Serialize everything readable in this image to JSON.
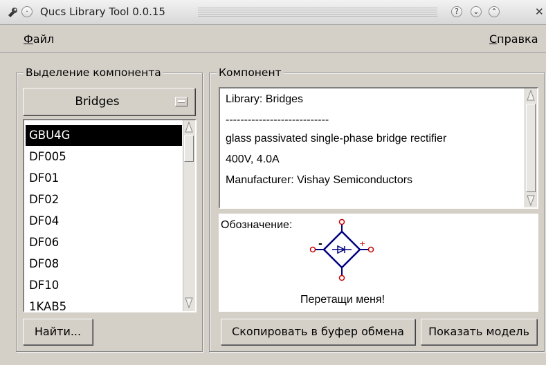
{
  "window": {
    "title": "Qucs Library Tool 0.0.15",
    "help_glyph": "?",
    "minimize_glyph": "⌄",
    "maximize_glyph": "⌃",
    "close_glyph": "✕"
  },
  "menu": {
    "file_first": "Ф",
    "file_rest": "айл",
    "help_first": "С",
    "help_rest": "правка"
  },
  "selection_group": {
    "title": "Выделение компонента",
    "library_selected": "Bridges",
    "items": [
      "GBU4G",
      "DF005",
      "DF01",
      "DF02",
      "DF04",
      "DF06",
      "DF08",
      "DF10",
      "1KAB5"
    ],
    "selected_index": 0,
    "search_button": "Найти..."
  },
  "component_group": {
    "title": "Компонент",
    "info_lines": [
      "Library: Bridges",
      "----------------------------",
      "glass passivated single-phase bridge rectifier",
      "400V, 4.0A",
      "Manufacturer: Vishay Semiconductors"
    ],
    "symbol_label": "Обозначение:",
    "drag_hint": "Перетащи меня!",
    "minus_sign": "-",
    "plus_sign": "+",
    "copy_button": "Скопировать в буфер обмена",
    "show_model_button": "Показать модель"
  },
  "colors": {
    "symbol_stroke": "#00007f",
    "pin_color": "#cc0000",
    "selection_bg": "#000000",
    "window_bg": "#d4d0c8"
  }
}
